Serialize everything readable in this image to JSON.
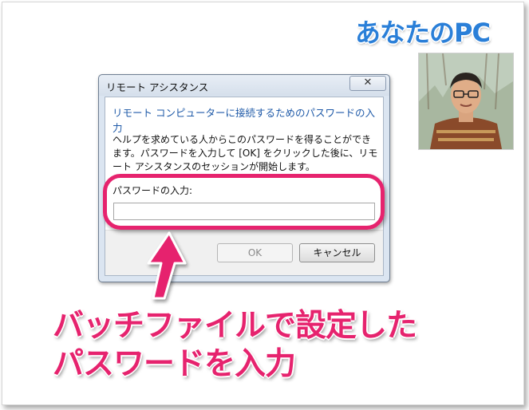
{
  "annotation": {
    "pc_label": "あなたのPC",
    "caption_line1": "バッチファイルで設定した",
    "caption_line2": "パスワードを入力",
    "highlight_color": "#e6236e",
    "label_color": "#2a7fd8"
  },
  "dialog": {
    "title": "リモート アシスタンス",
    "close_glyph": "✕",
    "heading": "リモート コンピューターに接続するためのパスワードの入力",
    "description": "ヘルプを求めている人からこのパスワードを得ることができます。パスワードを入力して [OK] をクリックした後に、リモート アシスタンスのセッションが開始します。",
    "password_label": "パスワードの入力:",
    "password_value": "",
    "ok_label": "OK",
    "cancel_label": "キャンセル"
  }
}
